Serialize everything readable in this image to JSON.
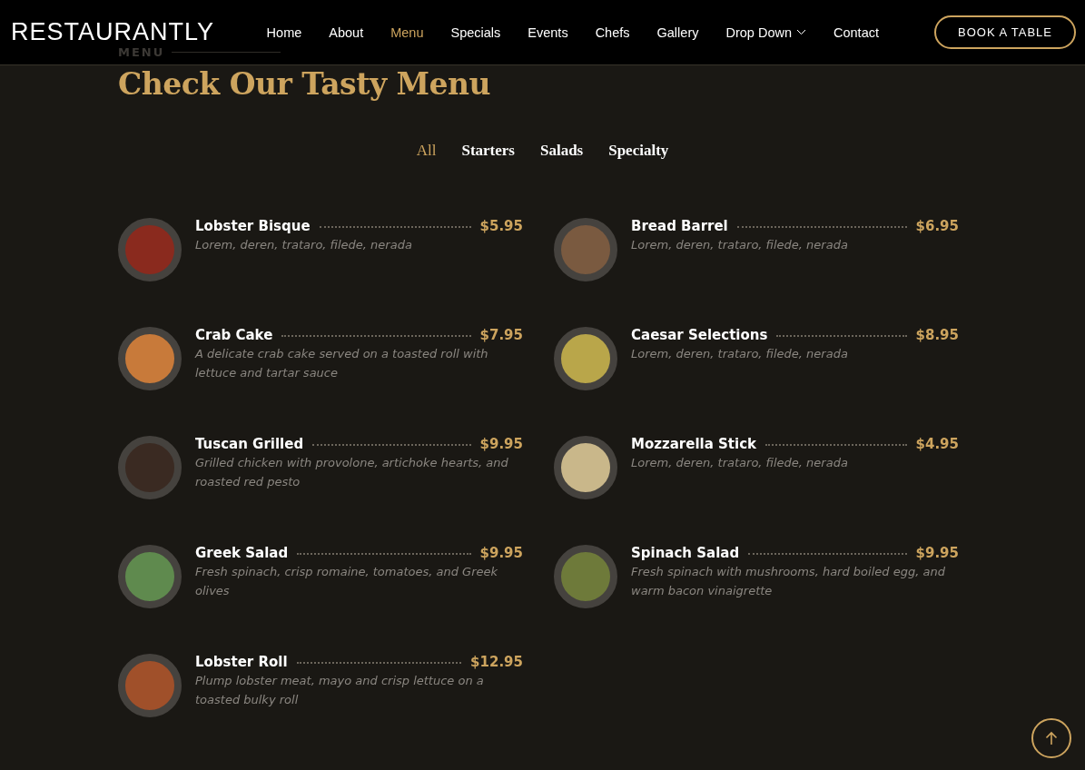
{
  "header": {
    "logo": "RESTAURANTLY",
    "nav": [
      {
        "label": "Home",
        "selected": false
      },
      {
        "label": "About",
        "selected": false
      },
      {
        "label": "Menu",
        "selected": true
      },
      {
        "label": "Specials",
        "selected": false
      },
      {
        "label": "Events",
        "selected": false
      },
      {
        "label": "Chefs",
        "selected": false
      },
      {
        "label": "Gallery",
        "selected": false
      },
      {
        "label": "Drop Down",
        "selected": false,
        "dropdown": true
      },
      {
        "label": "Contact",
        "selected": false
      }
    ],
    "cta": "BOOK A TABLE"
  },
  "section": {
    "label": "MENU",
    "title": "Check Our Tasty Menu"
  },
  "filters": [
    {
      "label": "All",
      "selected": true
    },
    {
      "label": "Starters",
      "selected": false
    },
    {
      "label": "Salads",
      "selected": false
    },
    {
      "label": "Specialty",
      "selected": false
    }
  ],
  "items": [
    {
      "name": "Lobster Bisque",
      "price": "$5.95",
      "description": "Lorem, deren, trataro, filede, nerada"
    },
    {
      "name": "Bread Barrel",
      "price": "$6.95",
      "description": "Lorem, deren, trataro, filede, nerada"
    },
    {
      "name": "Crab Cake",
      "price": "$7.95",
      "description": "A delicate crab cake served on a toasted roll with lettuce and tartar sauce"
    },
    {
      "name": "Caesar Selections",
      "price": "$8.95",
      "description": "Lorem, deren, trataro, filede, nerada"
    },
    {
      "name": "Tuscan Grilled",
      "price": "$9.95",
      "description": "Grilled chicken with provolone, artichoke hearts, and roasted red pesto"
    },
    {
      "name": "Mozzarella Stick",
      "price": "$4.95",
      "description": "Lorem, deren, trataro, filede, nerada"
    },
    {
      "name": "Greek Salad",
      "price": "$9.95",
      "description": "Fresh spinach, crisp romaine, tomatoes, and Greek olives"
    },
    {
      "name": "Spinach Salad",
      "price": "$9.95",
      "description": "Fresh spinach with mushrooms, hard boiled egg, and warm bacon vinaigrette"
    },
    {
      "name": "Lobster Roll",
      "price": "$12.95",
      "description": "Plump lobster meat, mayo and crisp lettuce on a toasted bulky roll"
    }
  ]
}
